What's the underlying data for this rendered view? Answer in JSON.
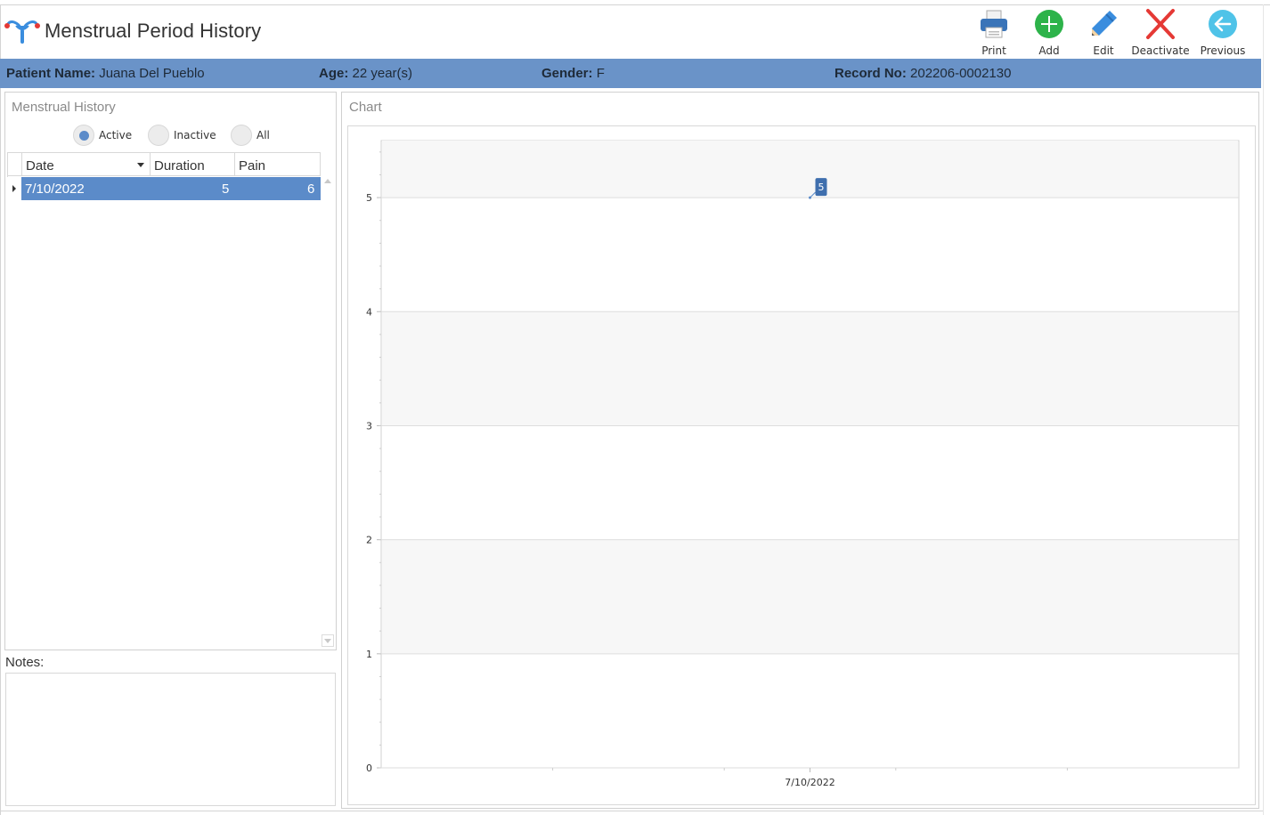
{
  "window": {
    "title": "Menstrual Period History"
  },
  "toolbar": {
    "print_label": "Print",
    "add_label": "Add",
    "edit_label": "Edit",
    "deactivate_label": "Deactivate",
    "previous_label": "Previous"
  },
  "patient": {
    "name_label": "Patient Name:",
    "name_value": "Juana Del Pueblo",
    "age_label": "Age:",
    "age_value": "22 year(s)",
    "gender_label": "Gender:",
    "gender_value": "F",
    "record_label": "Record No:",
    "record_value": "202206-0002130"
  },
  "history": {
    "group_title": "Menstrual History",
    "filters": [
      {
        "label": "Active",
        "checked": true
      },
      {
        "label": "Inactive",
        "checked": false
      },
      {
        "label": "All",
        "checked": false
      }
    ],
    "columns": [
      "Date",
      "Duration",
      "Pain"
    ],
    "rows": [
      {
        "date": "7/10/2022",
        "duration": "5",
        "pain": "6"
      }
    ]
  },
  "notes": {
    "label": "Notes:"
  },
  "chart": {
    "group_title": "Chart"
  },
  "colors": {
    "accent": "#5b8bc9",
    "patient_bar": "#6a93c8",
    "add_green": "#2db34a",
    "deactivate_red": "#e53935",
    "previous_teal": "#4fc3e8",
    "edit_blue": "#3a8dde"
  },
  "chart_data": {
    "type": "line",
    "categories": [
      "7/10/2022"
    ],
    "series": [
      {
        "values": [
          5
        ],
        "data_labels": [
          "5"
        ]
      }
    ],
    "ylim": [
      0,
      5.5
    ],
    "yticks": [
      0,
      1,
      2,
      3,
      4,
      5
    ],
    "xlabel": "",
    "ylabel": "",
    "title": "",
    "grid": true,
    "legend": "none"
  }
}
